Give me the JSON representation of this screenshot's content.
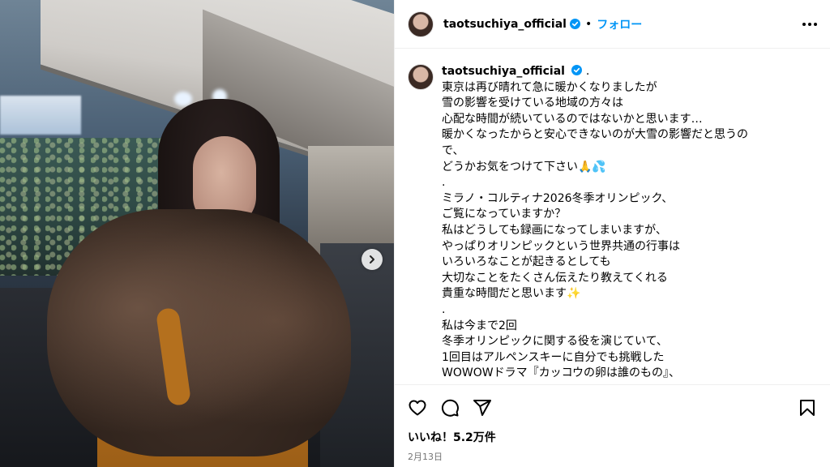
{
  "header": {
    "username": "taotsuchiya_official",
    "separator": "•",
    "follow_label": "フォロー"
  },
  "caption": {
    "username": "taotsuchiya_official",
    "lines": [
      ".",
      "東京は再び晴れて急に暖かくなりましたが",
      "雪の影響を受けている地域の方々は",
      "心配な時間が続いているのではないかと思います…",
      "暖かくなったからと安心できないのが大雪の影響だと思うの",
      "で、",
      "どうかお気をつけて下さい🙏💦",
      ".",
      "ミラノ・コルティナ2026冬季オリンピック、",
      "ご覧になっていますか？",
      "私はどうしても録画になってしまいますが、",
      "やっぱりオリンピックという世界共通の行事は",
      "いろいろなことが起きるとしても",
      "大切なことをたくさん伝えたり教えてくれる",
      "貴重な時間だと思います✨",
      ".",
      "私は今まで2回",
      "冬季オリンピックに関する役を演じていて、",
      "1回目はアルペンスキーに自分でも挑戦した",
      "WOWOWドラマ『カッコウの卵は誰のもの』、"
    ]
  },
  "post": {
    "likes": "いいね！5.2万件",
    "date": "2月13日"
  },
  "icons": [
    "verified-badge-icon",
    "more-options-icon",
    "heart-icon",
    "comment-icon",
    "share-icon",
    "bookmark-icon",
    "chevron-right-icon"
  ],
  "colors": {
    "accent": "#0095f6",
    "border": "#efefef",
    "muted": "#737373"
  }
}
